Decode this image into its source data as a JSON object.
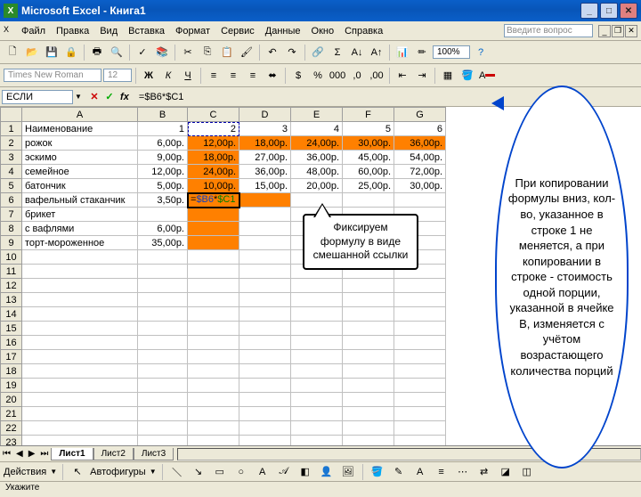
{
  "window": {
    "title": "Microsoft Excel - Книга1"
  },
  "menu": {
    "file": "Файл",
    "edit": "Правка",
    "view": "Вид",
    "insert": "Вставка",
    "format": "Формат",
    "service": "Сервис",
    "data": "Данные",
    "window": "Окно",
    "help": "Справка",
    "question_placeholder": "Введите вопрос"
  },
  "toolbar": {
    "zoom": "100%"
  },
  "format_bar": {
    "font": "Times New Roman",
    "size": "12"
  },
  "formula_bar": {
    "name_box": "ЕСЛИ",
    "cancel": "✕",
    "ok": "✓",
    "fx": "fx",
    "formula": "=$B6*$C1"
  },
  "columns": [
    "",
    "A",
    "B",
    "C",
    "D",
    "E",
    "F",
    "G"
  ],
  "rows": [
    "1",
    "2",
    "3",
    "4",
    "5",
    "6",
    "7",
    "8",
    "9",
    "10",
    "11",
    "12",
    "13",
    "14",
    "15",
    "16",
    "17",
    "18",
    "19",
    "20",
    "21",
    "22",
    "23"
  ],
  "cells": {
    "A1": "Наименование",
    "B1": "1",
    "C1": "2",
    "D1": "3",
    "E1": "4",
    "F1": "5",
    "G1": "6",
    "A2": "рожок",
    "B2": "6,00р.",
    "C2": "12,00р.",
    "D2": "18,00р.",
    "E2": "24,00р.",
    "F2": "30,00р.",
    "G2": "36,00р.",
    "A3": "эскимо",
    "B3": "9,00р.",
    "C3": "18,00р.",
    "D3": "27,00р.",
    "E3": "36,00р.",
    "F3": "45,00р.",
    "G3": "54,00р.",
    "A4": "семейное",
    "B4": "12,00р.",
    "C4": "24,00р.",
    "D4": "36,00р.",
    "E4": "48,00р.",
    "F4": "60,00р.",
    "G4": "72,00р.",
    "A5": "батончик",
    "B5": "5,00р.",
    "C5": "10,00р.",
    "D5": "15,00р.",
    "E5": "20,00р.",
    "F5": "25,00р.",
    "G5": "30,00р.",
    "A6": "вафельный стаканчик",
    "B6": "3,50р.",
    "C6": "=$B6*$C1",
    "A7": "брикет",
    "A8": "с вафлями",
    "B8": "6,00р.",
    "A9": "торт-мороженное",
    "B9": "35,00р."
  },
  "active_formula_parts": {
    "p1": "=",
    "p2": "$B6",
    "p3": "*",
    "p4": "$C1"
  },
  "callouts": {
    "mixed": "Фиксируем формулу в виде смешанной ссылки",
    "copy": "При копировании формулы вниз, кол-во, указанное в строке 1 не меняется, а при копировании в строке - стоимость одной порции, указанной в ячейке B, изменяется с учётом возрастающего количества порций"
  },
  "tabs": {
    "t1": "Лист1",
    "t2": "Лист2",
    "t3": "Лист3"
  },
  "draw_bar": {
    "actions": "Действия",
    "autoshapes": "Автофигуры"
  },
  "status": {
    "text": "Укажите"
  }
}
